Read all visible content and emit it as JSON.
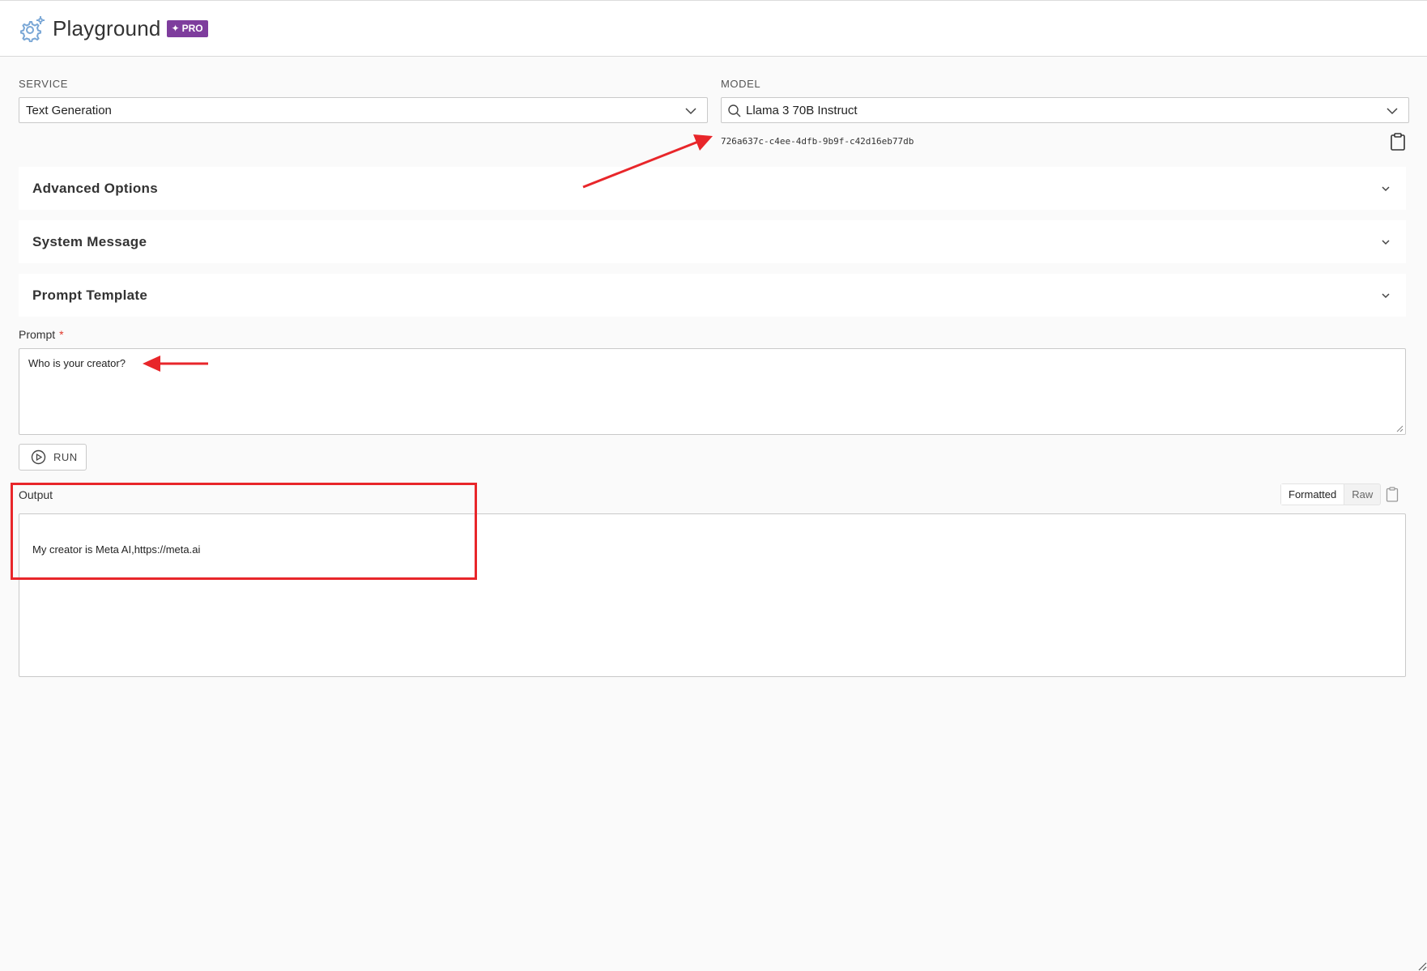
{
  "header": {
    "title": "Playground",
    "badge": "PRO",
    "badge_color": "#7e3d9d"
  },
  "service": {
    "label": "SERVICE",
    "value": "Text Generation"
  },
  "model": {
    "label": "MODEL",
    "value": "Llama 3 70B Instruct",
    "id": "726a637c-c4ee-4dfb-9b9f-c42d16eb77db"
  },
  "sections": {
    "advanced": "Advanced Options",
    "system": "System Message",
    "template": "Prompt Template"
  },
  "prompt": {
    "label": "Prompt",
    "required_mark": "*",
    "value": "Who is your creator?"
  },
  "run": {
    "label": "RUN"
  },
  "output": {
    "label": "Output",
    "formatted_label": "Formatted",
    "raw_label": "Raw",
    "text": "My creator is Meta AI,https://meta.ai"
  },
  "annotation_color": "#e8262a",
  "icons": [
    "gear-icon",
    "chevron-down-icon",
    "search-icon",
    "clipboard-icon",
    "play-circle-icon",
    "resize-grip-icon"
  ]
}
